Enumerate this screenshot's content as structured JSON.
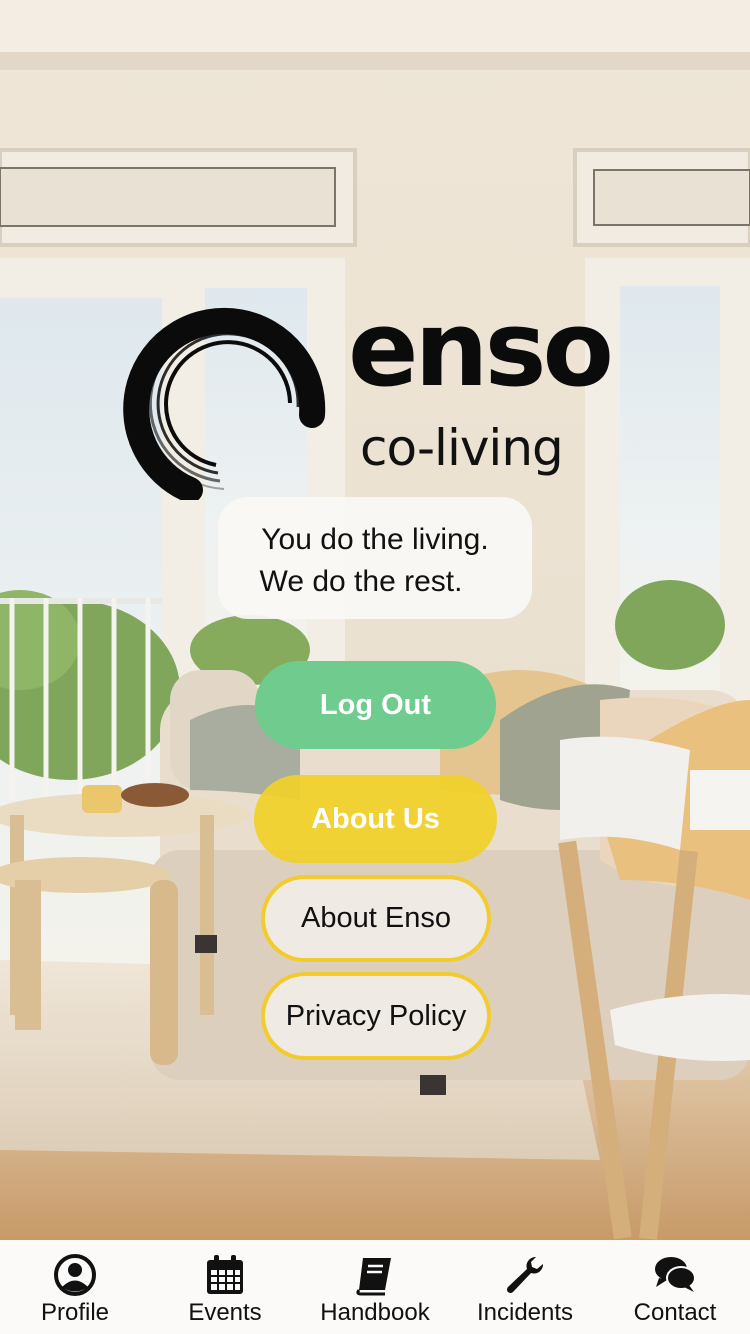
{
  "brand": {
    "name": "enso",
    "subtitle": "co-living"
  },
  "tagline": {
    "line1": "You do the living.",
    "line2": "We do the rest."
  },
  "actions": {
    "logout": "Log Out",
    "about_us": "About Us",
    "about_enso": "About Enso",
    "privacy_policy": "Privacy Policy"
  },
  "colors": {
    "logout_green": "#6fcb8e",
    "about_us_yellow": "#f0d028",
    "outline_yellow": "#f2cc2f",
    "tabbar_bg": "#fbfaf8"
  },
  "tabs": [
    {
      "label": "Profile",
      "icon": "user-circle-icon"
    },
    {
      "label": "Events",
      "icon": "calendar-icon"
    },
    {
      "label": "Handbook",
      "icon": "book-icon"
    },
    {
      "label": "Incidents",
      "icon": "wrench-icon"
    },
    {
      "label": "Contact",
      "icon": "chat-bubbles-icon"
    }
  ]
}
